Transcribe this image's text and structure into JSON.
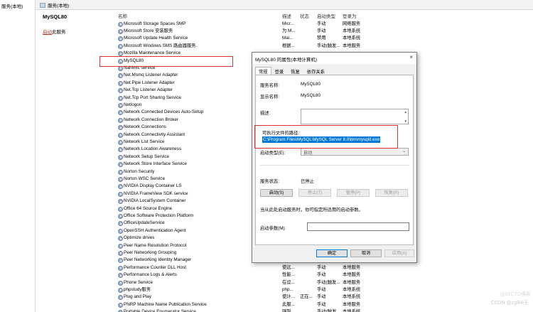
{
  "nav": {
    "root_label": "服务(本地)"
  },
  "tab_header": {
    "label": "服务(本地)"
  },
  "left_pane": {
    "title": "MySQL80",
    "link_action": "启动",
    "link_suffix": "此服务"
  },
  "columns": {
    "name": "名称",
    "desc": "描述",
    "status": "状态",
    "startup": "启动类型",
    "logon": "登录为"
  },
  "services": [
    {
      "name": "Microsoft Storage Spaces SMP",
      "desc": "Micr...",
      "status": "",
      "startup": "手动",
      "logon": "网络服务"
    },
    {
      "name": "Microsoft Store 安装服务",
      "desc": "为 M...",
      "status": "",
      "startup": "手动",
      "logon": "本地系统"
    },
    {
      "name": "Microsoft Update Health Service",
      "desc": "Mai...",
      "status": "",
      "startup": "禁用",
      "logon": "本地系统"
    },
    {
      "name": "Microsoft Windows SMS 路由器服务.",
      "desc": "根据...",
      "status": "",
      "startup": "手动(触发...",
      "logon": "本地服务"
    },
    {
      "name": "Mozilla Maintenance Service",
      "desc": "",
      "status": "",
      "startup": "",
      "logon": ""
    },
    {
      "name": "MySQL80",
      "desc": "",
      "status": "",
      "startup": "",
      "logon": ""
    },
    {
      "name": "Nahimic service",
      "desc": "",
      "status": "",
      "startup": "",
      "logon": ""
    },
    {
      "name": "Net.Msmq Listener Adapter",
      "desc": "",
      "status": "",
      "startup": "",
      "logon": ""
    },
    {
      "name": "Net.Pipe Listener Adapter",
      "desc": "",
      "status": "",
      "startup": "",
      "logon": ""
    },
    {
      "name": "Net.Tcp Listener Adapter",
      "desc": "",
      "status": "",
      "startup": "",
      "logon": ""
    },
    {
      "name": "Net.Tcp Port Sharing Service",
      "desc": "",
      "status": "",
      "startup": "",
      "logon": ""
    },
    {
      "name": "Netlogon",
      "desc": "",
      "status": "",
      "startup": "",
      "logon": ""
    },
    {
      "name": "Network Connected Devices Auto-Setup",
      "desc": "",
      "status": "",
      "startup": "",
      "logon": ""
    },
    {
      "name": "Network Connection Broker",
      "desc": "",
      "status": "",
      "startup": "",
      "logon": ""
    },
    {
      "name": "Network Connections",
      "desc": "",
      "status": "",
      "startup": "",
      "logon": ""
    },
    {
      "name": "Network Connectivity Assistant",
      "desc": "",
      "status": "",
      "startup": "",
      "logon": ""
    },
    {
      "name": "Network List Service",
      "desc": "",
      "status": "",
      "startup": "",
      "logon": ""
    },
    {
      "name": "Network Location Awareness",
      "desc": "",
      "status": "",
      "startup": "",
      "logon": ""
    },
    {
      "name": "Network Setup Service",
      "desc": "",
      "status": "",
      "startup": "",
      "logon": ""
    },
    {
      "name": "Network Store Interface Service",
      "desc": "",
      "status": "",
      "startup": "",
      "logon": ""
    },
    {
      "name": "Norton Security",
      "desc": "",
      "status": "",
      "startup": "",
      "logon": ""
    },
    {
      "name": "Norton WSC Service",
      "desc": "",
      "status": "",
      "startup": "",
      "logon": ""
    },
    {
      "name": "NVIDIA Display Container LS",
      "desc": "",
      "status": "",
      "startup": "",
      "logon": ""
    },
    {
      "name": "NVIDIA FrameView SDK service",
      "desc": "",
      "status": "",
      "startup": "",
      "logon": ""
    },
    {
      "name": "NVIDIA LocalSystem Container",
      "desc": "",
      "status": "",
      "startup": "",
      "logon": ""
    },
    {
      "name": "Office 64 Source Engine",
      "desc": "",
      "status": "",
      "startup": "",
      "logon": ""
    },
    {
      "name": "Office Software Protection Platform",
      "desc": "",
      "status": "",
      "startup": "",
      "logon": ""
    },
    {
      "name": "OfficeUpdateService",
      "desc": "",
      "status": "",
      "startup": "",
      "logon": ""
    },
    {
      "name": "OpenSSH Authentication Agent",
      "desc": "",
      "status": "",
      "startup": "",
      "logon": ""
    },
    {
      "name": "Optimize drives",
      "desc": "",
      "status": "",
      "startup": "",
      "logon": ""
    },
    {
      "name": "Peer Name Resolution Protocol",
      "desc": "",
      "status": "",
      "startup": "",
      "logon": ""
    },
    {
      "name": "Peer Networking Grouping",
      "desc": "",
      "status": "",
      "startup": "",
      "logon": ""
    },
    {
      "name": "Peer Networking Identity Manager",
      "desc": "",
      "status": "",
      "startup": "",
      "logon": ""
    },
    {
      "name": "Performance Counter DLL Host",
      "desc": "使远...",
      "status": "",
      "startup": "手动",
      "logon": "本地服务"
    },
    {
      "name": "Performance Logs & Alerts",
      "desc": "性能...",
      "status": "",
      "startup": "手动",
      "logon": "本地服务"
    },
    {
      "name": "Phone Service",
      "desc": "在设...",
      "status": "",
      "startup": "手动(触发...",
      "logon": "本地服务"
    },
    {
      "name": "phpstudy服务",
      "desc": "php...",
      "status": "",
      "startup": "手动",
      "logon": "本地系统"
    },
    {
      "name": "Plug and Play",
      "desc": "使计...",
      "status": "正在...",
      "startup": "手动",
      "logon": "本地系统"
    },
    {
      "name": "PNRP Machine Name Publication Service",
      "desc": "此服...",
      "status": "",
      "startup": "手动",
      "logon": "本地服务"
    },
    {
      "name": "Portable Device Enumerator Service",
      "desc": "强制...",
      "status": "",
      "startup": "手动(触发...",
      "logon": "本地系统"
    }
  ],
  "dialog": {
    "title": "MySQL80 的属性(本地计算机)",
    "close_glyph": "×",
    "tabs": [
      "常规",
      "登录",
      "恢复",
      "依存关系"
    ],
    "service_name_label": "服务名称:",
    "service_name_value": "MySQL80",
    "display_name_label": "显示名称:",
    "display_name_value": "MySQL80",
    "description_label": "描述:",
    "path_label": "可执行文件的路径:",
    "path_value": "C:\\Program Files\\MySQL\\MySQL Server 8.0\\bin\\mysqld.exe",
    "startup_type_label": "启动类型(E):",
    "startup_type_value": "自动",
    "status_label": "服务状态:",
    "status_value": "已停止",
    "btn_start": "启动(S)",
    "btn_stop": "停止(T)",
    "btn_pause": "暂停(P)",
    "btn_resume": "恢复(R)",
    "hint": "当从此处启动服务时，你可指定所适用的启动参数。",
    "params_label": "启动参数(M):",
    "btn_ok": "确定",
    "btn_cancel": "取消",
    "btn_apply": "应用(A)"
  },
  "watermark": {
    "text": "CSDN @zgB4i王",
    "text2": "@51CTO博客"
  },
  "colors": {
    "highlight_red": "#e03030",
    "selection_blue": "#0078d7"
  }
}
